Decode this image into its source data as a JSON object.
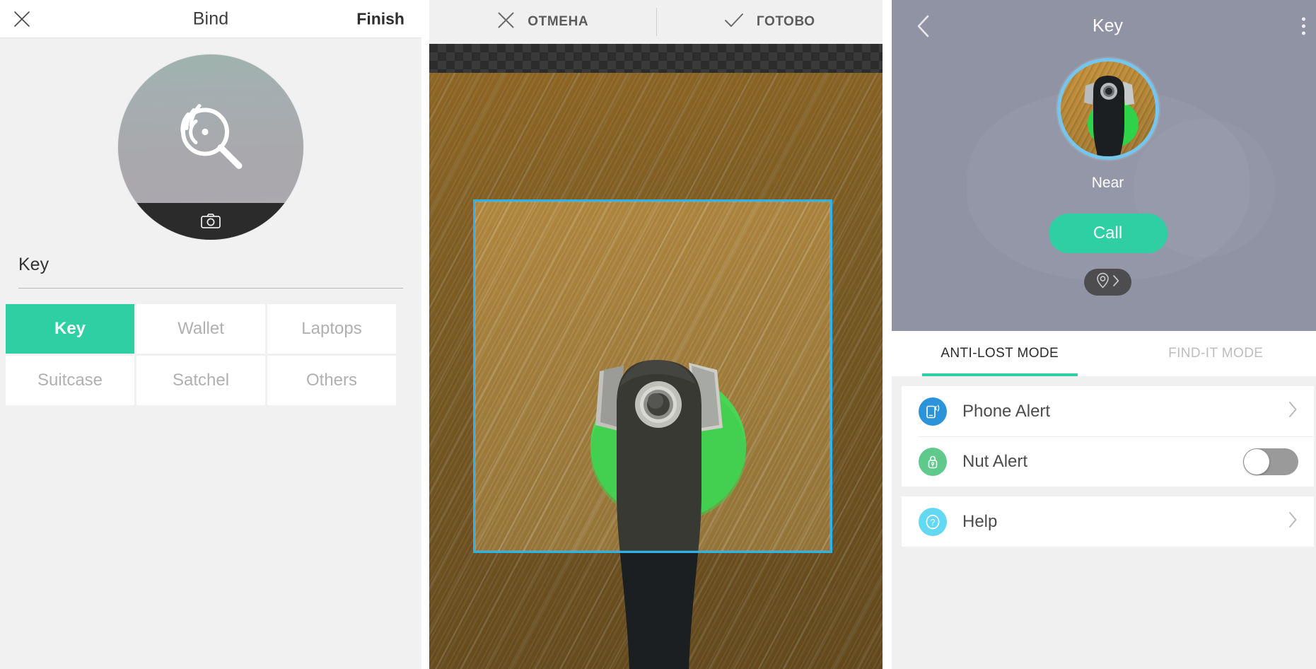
{
  "bind_screen": {
    "header": {
      "close_icon": "close-icon",
      "title": "Bind",
      "finish_label": "Finish"
    },
    "avatar": {
      "icon": "nut-tracker-magnifier-icon",
      "camera_icon": "camera-icon"
    },
    "name_field": {
      "value": "Key",
      "placeholder": "Key"
    },
    "categories": [
      {
        "label": "Key",
        "selected": true
      },
      {
        "label": "Wallet",
        "selected": false
      },
      {
        "label": "Laptops",
        "selected": false
      },
      {
        "label": "Suitcase",
        "selected": false
      },
      {
        "label": "Satchel",
        "selected": false
      },
      {
        "label": "Others",
        "selected": false
      }
    ]
  },
  "crop_screen": {
    "header": {
      "cancel_label": "ОТМЕНА",
      "cancel_icon": "close-icon",
      "done_label": "ГОТОВО",
      "done_icon": "check-icon"
    },
    "crop_rect_color": "#2ab4ef"
  },
  "detail_screen": {
    "header": {
      "back_icon": "chevron-left-icon",
      "title": "Key",
      "menu_icon": "overflow-menu-icon"
    },
    "status_label": "Near",
    "call_label": "Call",
    "location_pill": {
      "pin_icon": "map-pin-icon",
      "chevron_icon": "chevron-right-icon"
    },
    "tabs": [
      {
        "label": "ANTI-LOST MODE",
        "active": true
      },
      {
        "label": "FIND-IT MODE",
        "active": false
      }
    ],
    "rows": [
      {
        "label": "Phone Alert",
        "icon": "phone-alert-icon",
        "accent": "#2b93d9",
        "control": "chevron"
      },
      {
        "label": "Nut Alert",
        "icon": "nut-alert-icon",
        "accent": "#5ec98a",
        "control": "toggle",
        "toggle_on": false
      },
      {
        "label": "Help",
        "icon": "help-icon",
        "accent": "#62d8f2",
        "control": "chevron"
      }
    ]
  },
  "theme": {
    "accent_green": "#2ecfa2",
    "accent_blue": "#2ab4ef",
    "hero_gray": "#8f93a4"
  }
}
